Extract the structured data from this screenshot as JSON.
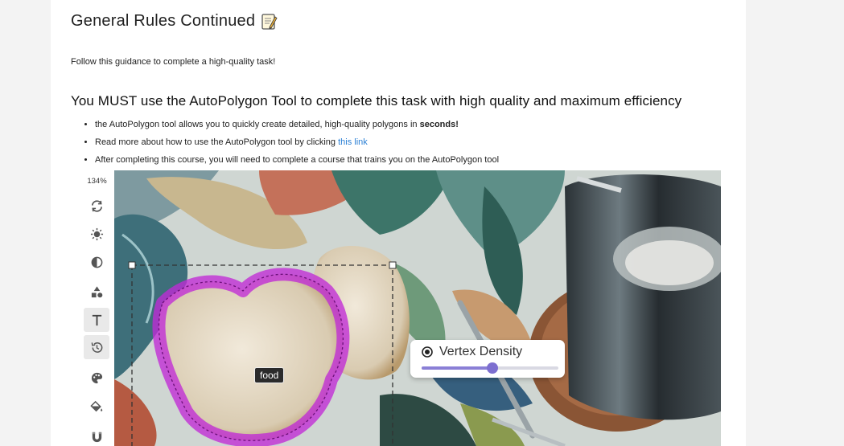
{
  "page": {
    "title": "General Rules Continued",
    "title_emoji": "memo-icon",
    "intro": "Follow this guidance to complete a high-quality task!",
    "heading": "You MUST use the AutoPolygon Tool to complete this task with high quality and maximum efficiency",
    "bullets": {
      "b1_text": "the AutoPolygon tool allows you to quickly create detailed, high-quality polygons in ",
      "b1_strong": "seconds!",
      "b2_text": "Read more about how to use the AutoPolygon tool by clicking ",
      "b2_link": "this link",
      "b3_text": "After completing this course, you will need to complete a course that trains you on the AutoPolygon tool"
    }
  },
  "editor": {
    "zoom": "134%",
    "tools": [
      "refresh-icon",
      "brightness-icon",
      "contrast-icon",
      "shapes-icon",
      "text-icon",
      "history-icon",
      "palette-icon",
      "fill-icon",
      "magnet-icon"
    ],
    "annotation_label": "food",
    "vertex_panel": {
      "label": "Vertex Density",
      "slider_value": 0.52
    }
  },
  "colors": {
    "accent_link": "#2a7fd4",
    "polygon": "#c02ad6",
    "slider": "#8a7fd6"
  }
}
